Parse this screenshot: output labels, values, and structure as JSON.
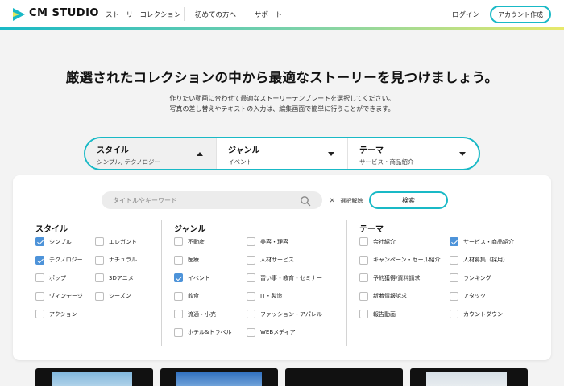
{
  "header": {
    "logo_text": "CM STUDIO",
    "nav": [
      "ストーリーコレクション",
      "初めての方へ",
      "サポート"
    ],
    "login": "ログイン",
    "account_button": "アカウント作成"
  },
  "hero": {
    "title": "厳選されたコレクションの中から最適なストーリーを見つけましょう。",
    "sub1": "作りたい動画に合わせて最適なストーリーテンプレートを選択してください。",
    "sub2": "写真の差し替えやテキストの入力は、編集画面で簡単に行うことができます。"
  },
  "filter_bar": [
    {
      "label": "スタイル",
      "value": "シンプル, テクノロジー",
      "open": true
    },
    {
      "label": "ジャンル",
      "value": "イベント",
      "open": false
    },
    {
      "label": "テーマ",
      "value": "サービス・商品紹介",
      "open": false
    }
  ],
  "panel": {
    "search_placeholder": "タイトルやキーワード",
    "clear_label": "選択解除",
    "search_button": "検索",
    "columns": [
      {
        "title": "スタイル",
        "options": [
          {
            "label": "シンプル",
            "checked": true
          },
          {
            "label": "エレガント",
            "checked": false
          },
          {
            "label": "テクノロジー",
            "checked": true
          },
          {
            "label": "ナチュラル",
            "checked": false
          },
          {
            "label": "ポップ",
            "checked": false
          },
          {
            "label": "3Dアニメ",
            "checked": false
          },
          {
            "label": "ヴィンテージ",
            "checked": false
          },
          {
            "label": "シーズン",
            "checked": false
          },
          {
            "label": "アクション",
            "checked": false
          }
        ]
      },
      {
        "title": "ジャンル",
        "options": [
          {
            "label": "不動産",
            "checked": false
          },
          {
            "label": "美容・理容",
            "checked": false
          },
          {
            "label": "医療",
            "checked": false
          },
          {
            "label": "人材サービス",
            "checked": false
          },
          {
            "label": "イベント",
            "checked": true
          },
          {
            "label": "習い事・教育・セミナー",
            "checked": false
          },
          {
            "label": "飲食",
            "checked": false
          },
          {
            "label": "IT・製造",
            "checked": false
          },
          {
            "label": "流通・小売",
            "checked": false
          },
          {
            "label": "ファッション・アパレル",
            "checked": false
          },
          {
            "label": "ホテル&トラベル",
            "checked": false
          },
          {
            "label": "WEBメディア",
            "checked": false
          }
        ]
      },
      {
        "title": "テーマ",
        "options": [
          {
            "label": "会社紹介",
            "checked": false
          },
          {
            "label": "サービス・商品紹介",
            "checked": true
          },
          {
            "label": "キャンペーン・セール紹介",
            "checked": false
          },
          {
            "label": "人材募集（採用）",
            "checked": false
          },
          {
            "label": "予約獲得/資料請求",
            "checked": false
          },
          {
            "label": "ランキング",
            "checked": false
          },
          {
            "label": "新着情報訴求",
            "checked": false
          },
          {
            "label": "アタック",
            "checked": false
          },
          {
            "label": "報告動画",
            "checked": false
          },
          {
            "label": "カウントダウン",
            "checked": false
          }
        ]
      }
    ]
  },
  "colors": {
    "accent": "#19b9c6",
    "checkbox": "#4d93d9"
  }
}
